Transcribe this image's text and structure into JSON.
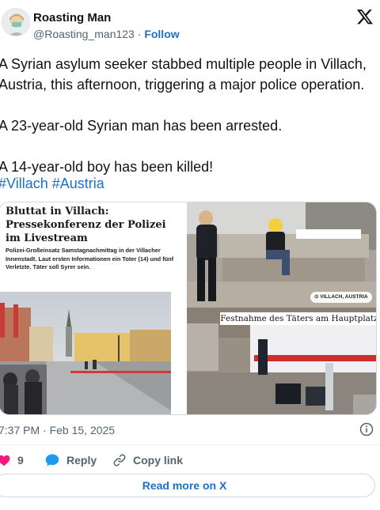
{
  "author": {
    "name": "Roasting Man",
    "handle": "@Roasting_man123",
    "separator": "·",
    "follow_label": "Follow"
  },
  "tweet": {
    "text": "A Syrian asylum seeker stabbed multiple people in Villach, Austria, this afternoon, triggering a major police operation.\n\nA 23-year-old Syrian man has been arrested.\n\nA 14-year-old boy has been killed!",
    "hashtags": [
      "#Villach",
      "#Austria"
    ]
  },
  "media": {
    "article_title": "Bluttat in Villach: Pressekonferenz der Polizei im Livestream",
    "article_body": "Polizei-Großeinsatz Samstagnachmittag in der Villacher Innenstadt. Laut ersten Informationen ein Toter (14) und fünf Verletzte. Täter soll Syrer sein.",
    "location_tag": "VILLACH, AUSTRIA",
    "caption": "Festnahme des Täters am Hauptplatz"
  },
  "meta": {
    "timestamp": "7:37 PM · Feb 15, 2025"
  },
  "actions": {
    "like_count": "9",
    "reply_label": "Reply",
    "copy_label": "Copy link",
    "read_more_label": "Read more on X"
  },
  "colors": {
    "link": "#1d70c8",
    "like": "#f91880",
    "text": "#0f1419",
    "muted": "#536471"
  }
}
